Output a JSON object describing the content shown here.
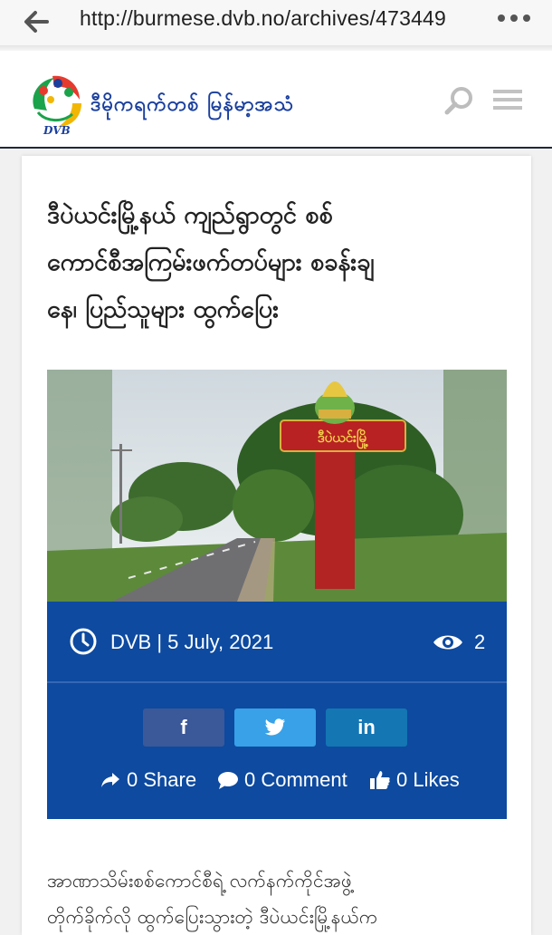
{
  "browser": {
    "url": "http://burmese.dvb.no/archives/473449"
  },
  "header": {
    "brand": "ဒီမိုကရက်တစ် မြန်မာ့အသံ",
    "logo_text": "DVB"
  },
  "article": {
    "title_lines": [
      "ဒီပဲယင်းမြို့နယ် ကျည်ရွာတွင် စစ်",
      "ကောင်စီအကြမ်းဖက်တပ်များ စခန်းချ",
      "နေ၊ ပြည်သူများ ထွက်ပြေး"
    ],
    "image_sign_text": "ဒီပဲယင်းမြို့",
    "meta": "DVB | 5 July, 2021",
    "views": "2",
    "share_buttons": [
      "f",
      "t",
      "in"
    ],
    "stats": {
      "share": "0 Share",
      "comment": "0 Comment",
      "likes": "0 Likes"
    },
    "body_lines": [
      "အာဏာသိမ်းစစ်ကောင်စီရဲ့ လက်နက်ကိုင်အဖွဲ့",
      "တိုက်ခိုက်လို ထွက်ပြေးသွားတဲ့ ဒီပဲယင်းမြို့နယ်က"
    ]
  },
  "colors": {
    "panel": "#0d4aa0",
    "facebook": "#3b5898",
    "twitter": "#38a1e8",
    "linkedin": "#1476b3"
  }
}
